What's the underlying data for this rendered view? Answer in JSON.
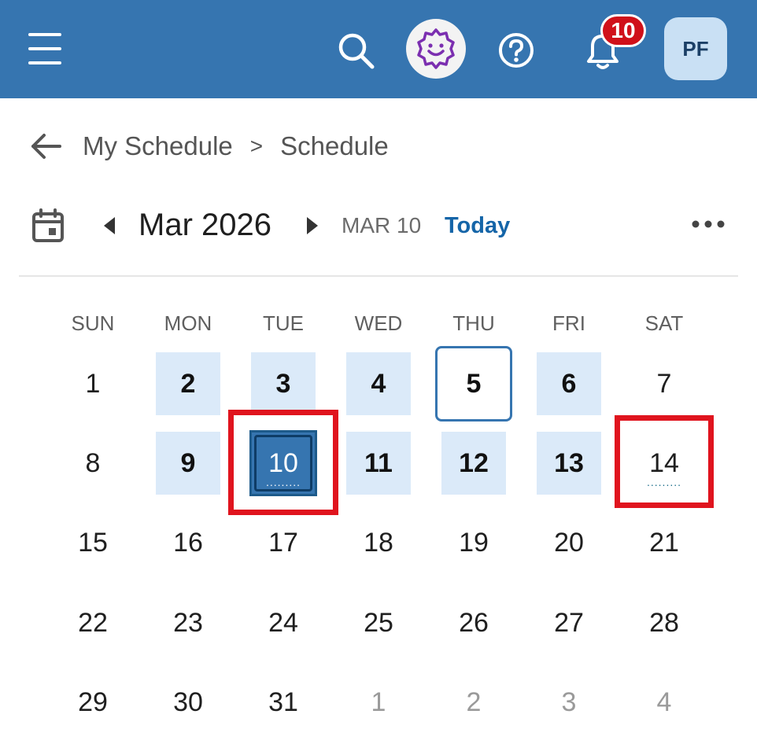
{
  "header": {
    "notification_count": "10",
    "avatar_initials": "PF",
    "colors": {
      "bar": "#3675b0",
      "badge": "#d0101a",
      "assistant": "#7b2fb0"
    }
  },
  "breadcrumb": {
    "items": [
      "My Schedule",
      "Schedule"
    ],
    "separator": ">"
  },
  "calendar": {
    "month_title": "Mar 2026",
    "current_date_label": "MAR 10",
    "today_label": "Today",
    "weekdays": [
      "SUN",
      "MON",
      "TUE",
      "WED",
      "THU",
      "FRI",
      "SAT"
    ],
    "weeks": [
      [
        "1",
        "2",
        "3",
        "4",
        "5",
        "6",
        "7"
      ],
      [
        "8",
        "9",
        "10",
        "11",
        "12",
        "13",
        "14"
      ],
      [
        "15",
        "16",
        "17",
        "18",
        "19",
        "20",
        "21"
      ],
      [
        "22",
        "23",
        "24",
        "25",
        "26",
        "27",
        "28"
      ],
      [
        "29",
        "30",
        "31",
        "1",
        "2",
        "3",
        "4"
      ]
    ],
    "scheduled_days": [
      "2",
      "3",
      "4",
      "5",
      "6",
      "9",
      "10",
      "11",
      "12",
      "13"
    ],
    "selected_day": "10",
    "today_ring_day": "5",
    "days_with_events": [
      "10",
      "14"
    ],
    "highlighted_days": [
      "10",
      "14"
    ],
    "highlight_color": "#e0141e",
    "scheduled_color": "#dbeaf9"
  }
}
